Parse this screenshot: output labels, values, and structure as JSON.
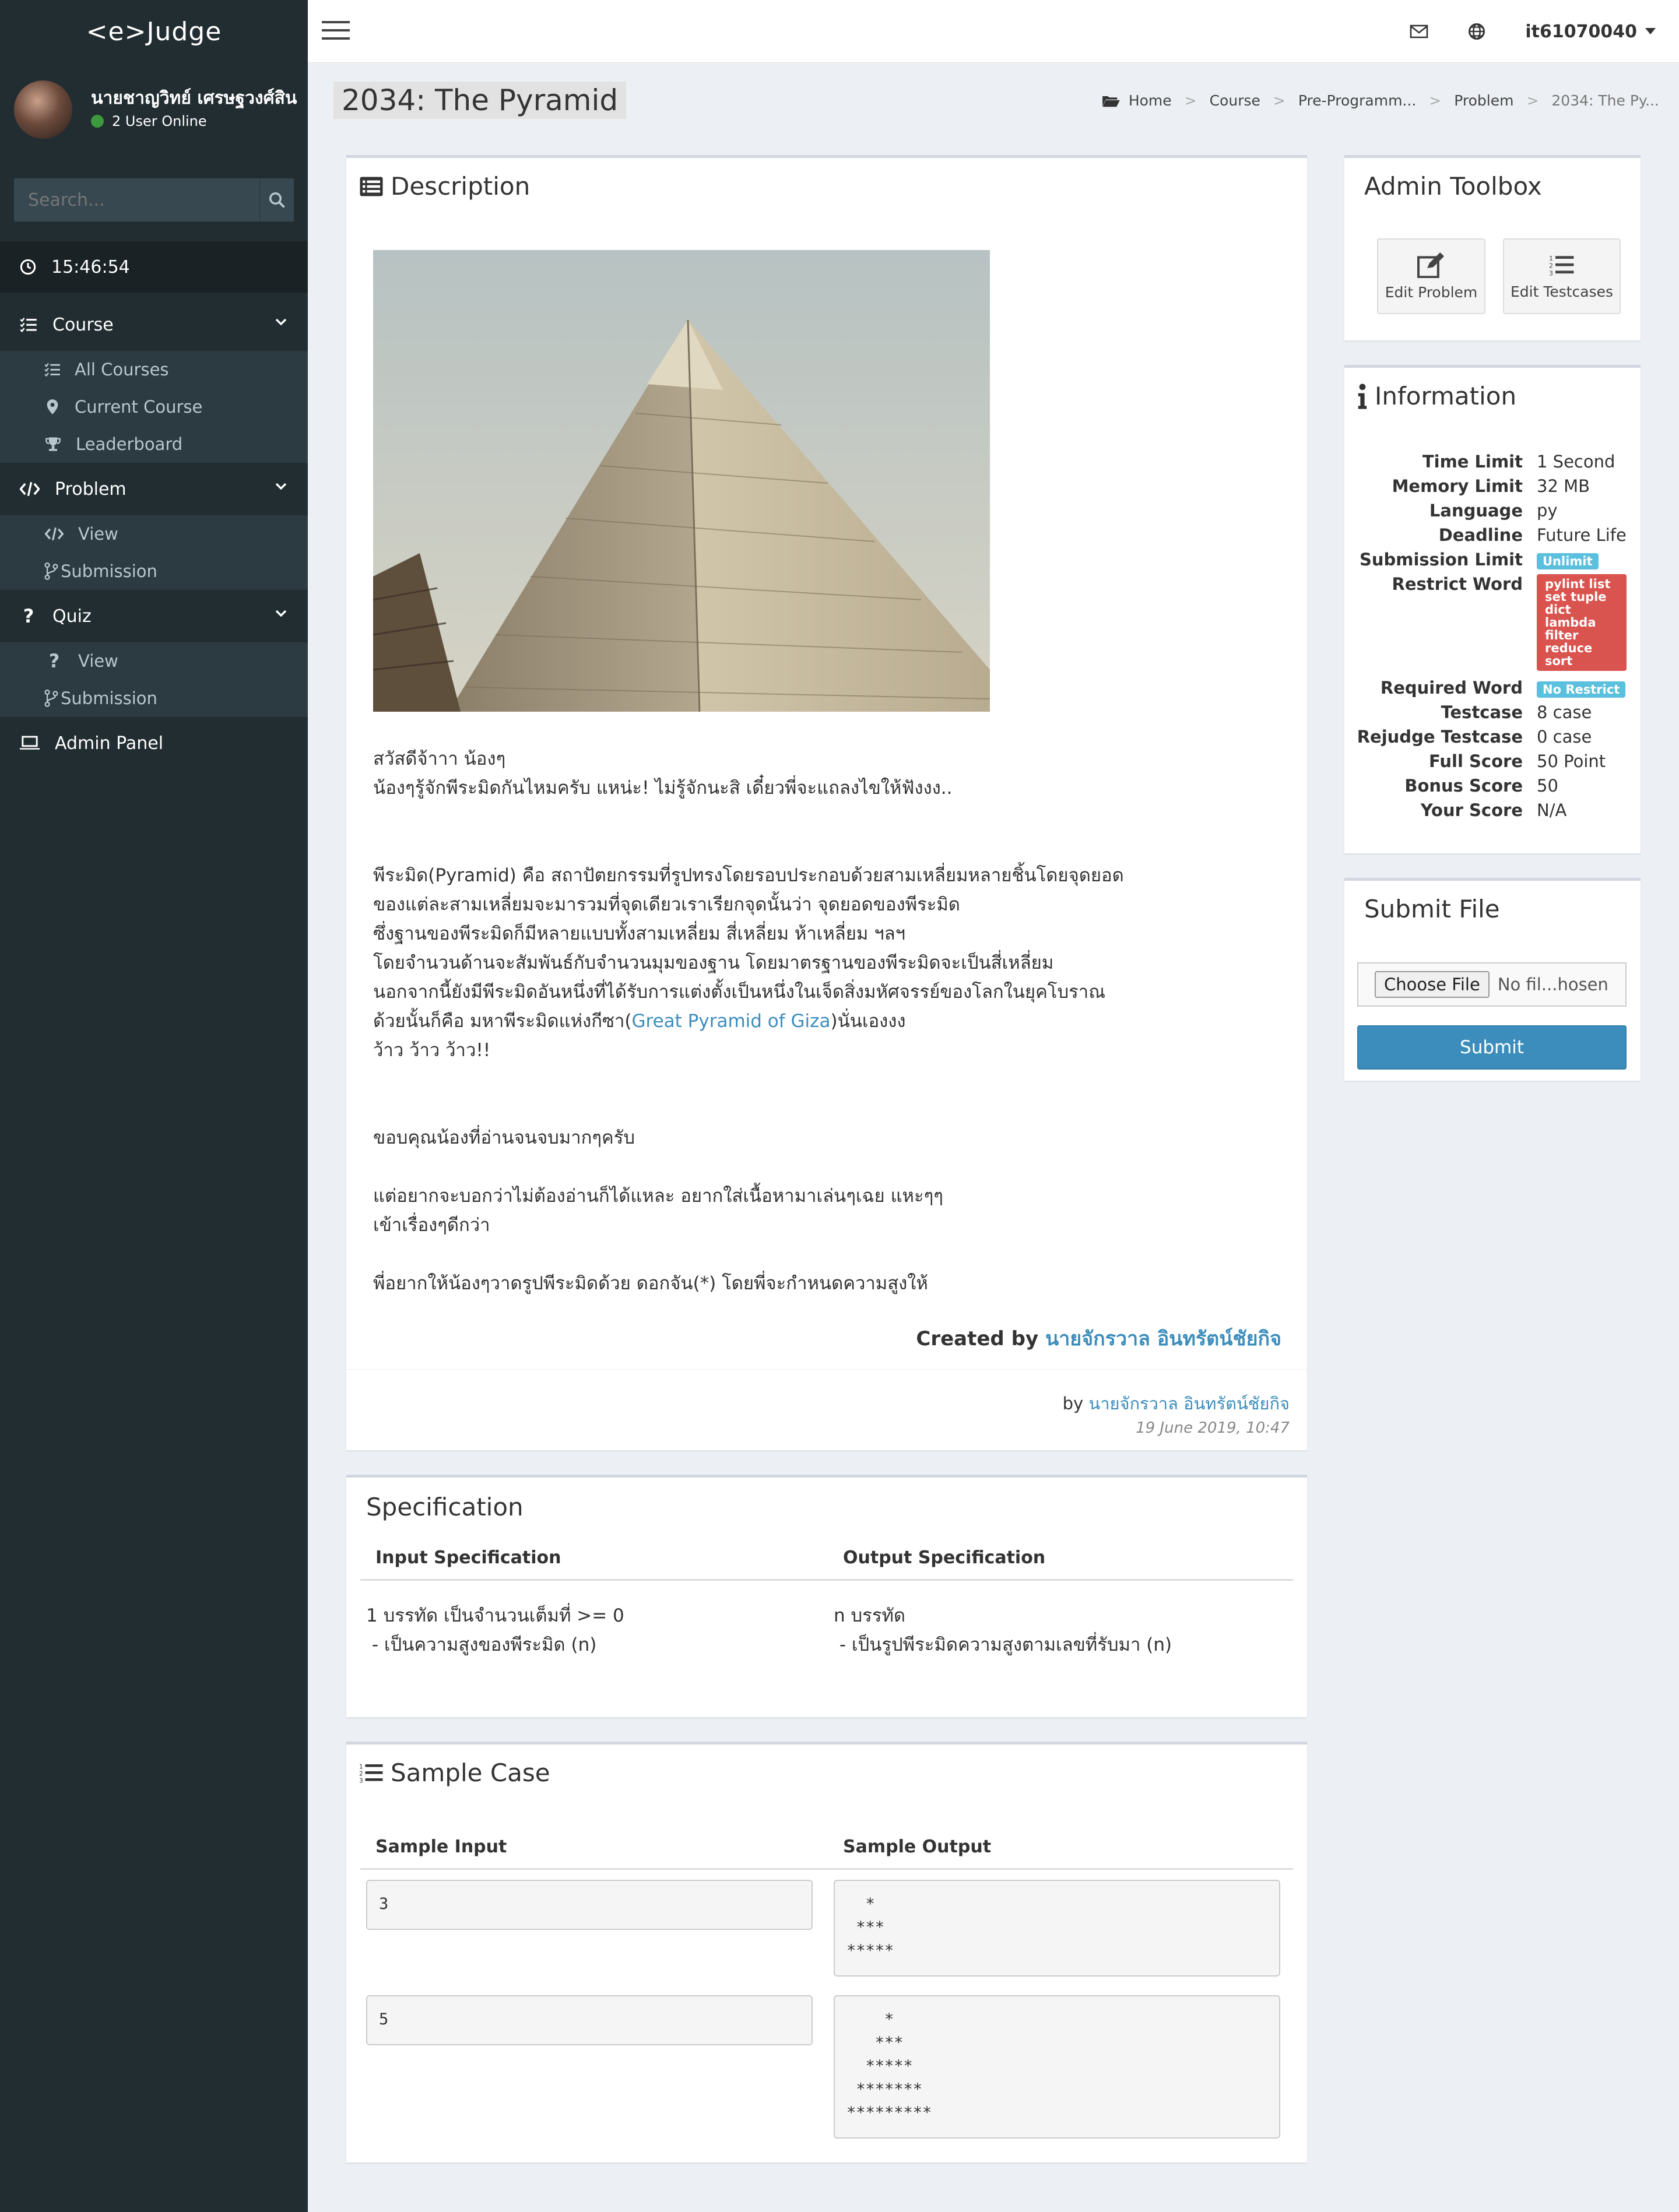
{
  "app": {
    "logo": "<e>Judge"
  },
  "user": {
    "name": "นายชาญวิทย์ เศรษฐวงศ์สิน",
    "status": "2 User Online",
    "username": "it61070040"
  },
  "search": {
    "placeholder": "Search..."
  },
  "clock": "15:46:54",
  "menu": {
    "course": {
      "label": "Course",
      "items": [
        "All Courses",
        "Current Course",
        "Leaderboard"
      ]
    },
    "problem": {
      "label": "Problem",
      "items": [
        "View",
        "Submission"
      ]
    },
    "quiz": {
      "label": "Quiz",
      "items": [
        "View",
        "Submission"
      ]
    },
    "admin": "Admin Panel"
  },
  "page": {
    "title": "2034: The Pyramid"
  },
  "breadcrumb": [
    "Home",
    "Course",
    "Pre-Programm...",
    "Problem",
    "2034: The Py..."
  ],
  "description": {
    "title": "Description",
    "greeting1": "สวัสดีจ้าาา น้องๆ",
    "greeting2": "น้องๆรู้จักพีระมิดกันไหมครับ แหน่ะ! ไม่รู้จักนะสิ เดี๋ยวพี่จะแถลงไขให้ฟังงง..",
    "para1": "พีระมิด(Pyramid) คือ สถาปัตยกรรมที่รูปทรงโดยรอบประกอบด้วยสามเหลี่ยมหลายชิ้นโดยจุดยอด",
    "para2": "ของแต่ละสามเหลี่ยมจะมารวมที่จุดเดียวเราเรียกจุดนั้นว่า จุดยอดของพีระมิด",
    "para3": "ซึ่งฐานของพีระมิดก็มีหลายแบบทั้งสามเหลี่ยม สี่เหลี่ยม ห้าเหลี่ยม ฯลฯ",
    "para4": "โดยจำนวนด้านจะสัมพันธ์กับจำนวนมุมของฐาน โดยมาตรฐานของพีระมิดจะเป็นสี่เหลี่ยม",
    "para5": "นอกจากนี้ยังมีพีระมิดอันหนึ่งที่ได้รับการแต่งตั้งเป็นหนึ่งในเจ็ดสิ่งมหัศจรรย์ของโลกในยุคโบราณ",
    "para6_pre": "ด้วยนั้นก็คือ มหาพีระมิดแห่งกีซา(",
    "para6_link": "Great Pyramid of Giza",
    "para6_post": ")นั่นเองงง",
    "para7": "ว้าว ว้าว ว้าว!!",
    "thanks": "ขอบคุณน้องที่อ่านจนจบมากๆครับ",
    "joke1": "แต่อยากจะบอกว่าไม่ต้องอ่านก็ได้แหละ อยากใส่เนื้อหามาเล่นๆเฉย แหะๆๆ",
    "joke2": "เข้าเรื่องๆดีกว่า",
    "task": "พี่อยากให้น้องๆวาดรูปพีระมิดด้วย ดอกจัน(*) โดยพี่จะกำหนดความสูงให้",
    "created_label": "Created by",
    "author": "นายจักรวาล อินทรัตน์ชัยกิจ",
    "by_label": "by",
    "by_author": "นายจักรวาล อินทรัตน์ชัยกิจ",
    "date": "19 June 2019, 10:47"
  },
  "specification": {
    "title": "Specification",
    "input_header": "Input Specification",
    "output_header": "Output Specification",
    "input_text": "1 บรรทัด เป็นจำนวนเต็มที่ >= 0\n - เป็นความสูงของพีระมิด (n)",
    "output_text": "n บรรทัด\n - เป็นรูปพีระมิดความสูงตามเลขที่รับมา (n)"
  },
  "sample": {
    "title": "Sample Case",
    "input_header": "Sample Input",
    "output_header": "Sample Output",
    "cases": [
      {
        "input": "3",
        "output": "  *\n ***\n*****"
      },
      {
        "input": "5",
        "output": "    *\n   ***\n  *****\n *******\n*********"
      }
    ]
  },
  "toolbox": {
    "title": "Admin Toolbox",
    "edit_problem": "Edit Problem",
    "edit_testcases": "Edit Testcases"
  },
  "information": {
    "title": "Information",
    "time_limit_label": "Time Limit",
    "time_limit": "1 Second",
    "memory_limit_label": "Memory Limit",
    "memory_limit": "32 MB",
    "language_label": "Language",
    "language": "py",
    "deadline_label": "Deadline",
    "deadline": "Future Life",
    "submission_limit_label": "Submission Limit",
    "submission_limit": "Unlimit",
    "restrict_word_label": "Restrict Word",
    "restrict_words": [
      "pylint list",
      "set tuple",
      "dict",
      "lambda",
      "filter",
      "reduce",
      "sort"
    ],
    "required_word_label": "Required Word",
    "required_word": "No Restrict",
    "testcase_label": "Testcase",
    "testcase": "8 case",
    "rejudge_label": "Rejudge Testcase",
    "rejudge": "0 case",
    "full_score_label": "Full Score",
    "full_score": "50 Point",
    "bonus_score_label": "Bonus Score",
    "bonus_score": "50",
    "your_score_label": "Your Score",
    "your_score": "N/A"
  },
  "submit": {
    "title": "Submit File",
    "choose": "Choose File",
    "no_file": "No fil...hosen",
    "button": "Submit"
  },
  "colors": {
    "sidebar": "#222d32",
    "accent": "#3c8dbc",
    "badge_blue": "#5bc0de",
    "badge_red": "#d9534f"
  }
}
